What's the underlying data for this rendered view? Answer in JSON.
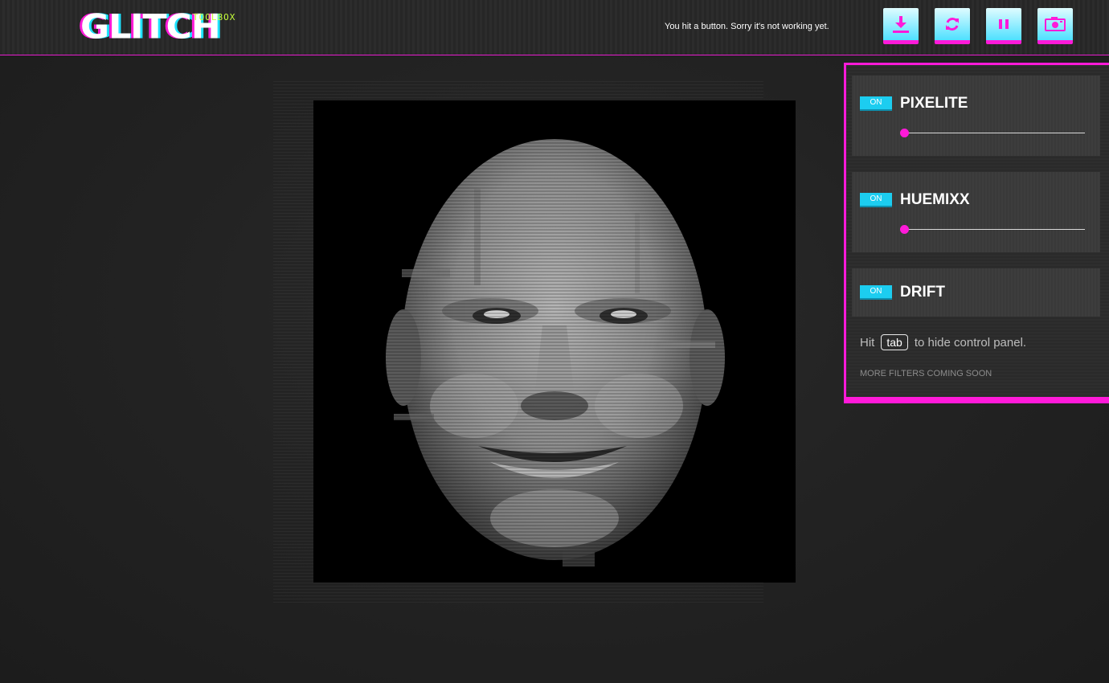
{
  "app": {
    "logo": "GLITCH",
    "logo_sub": "TOOLBOX",
    "status_message": "You hit a button. Sorry it's not working yet."
  },
  "toolbar": {
    "buttons": [
      {
        "name": "download",
        "icon": "download-icon"
      },
      {
        "name": "refresh",
        "icon": "refresh-icon"
      },
      {
        "name": "pause",
        "icon": "pause-icon"
      },
      {
        "name": "camera",
        "icon": "camera-icon"
      }
    ]
  },
  "colors": {
    "accent_pink": "#ff1ad9",
    "accent_cyan": "#1ccdf0",
    "logo_sub": "#c6ff3a"
  },
  "panel": {
    "filters": [
      {
        "state": "ON",
        "name": "PIXELITE",
        "slider_value": 0.0,
        "has_slider": true
      },
      {
        "state": "ON",
        "name": "HUEMIXX",
        "slider_value": 0.0,
        "has_slider": true
      },
      {
        "state": "ON",
        "name": "DRIFT",
        "has_slider": false
      }
    ],
    "hint_prefix": "Hit",
    "hint_key": "tab",
    "hint_suffix": "to hide control panel.",
    "more_filters": "MORE FILTERS COMING SOON"
  },
  "canvas": {
    "content": "glitched-face-image"
  }
}
